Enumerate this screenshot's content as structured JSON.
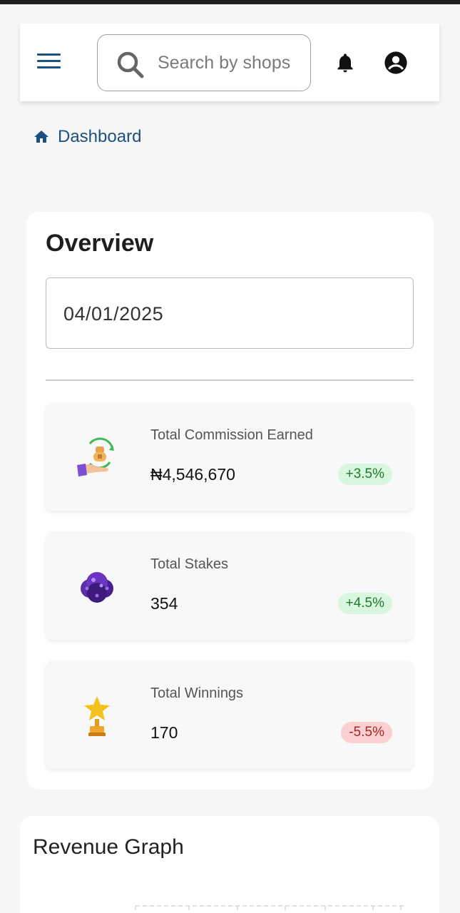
{
  "header": {
    "search_placeholder": "Search by shops",
    "icons": {
      "menu": "menu-icon",
      "search": "search-icon",
      "bell": "bell-icon",
      "account": "account-circle-icon"
    }
  },
  "breadcrumb": {
    "label": "Dashboard",
    "icon": "home-icon"
  },
  "overview": {
    "title": "Overview",
    "date_value": "04/01/2025",
    "stats": [
      {
        "label": "Total Commission Earned",
        "value": "₦4,546,670",
        "change": "+3.5%",
        "trend": "up",
        "icon": "hand-coin-icon"
      },
      {
        "label": "Total Stakes",
        "value": "354",
        "change": "+4.5%",
        "trend": "up",
        "icon": "dice-icon"
      },
      {
        "label": "Total Winnings",
        "value": "170",
        "change": "-5.5%",
        "trend": "down",
        "icon": "trophy-star-icon"
      }
    ]
  },
  "revenue": {
    "title": "Revenue Graph"
  },
  "colors": {
    "primary": "#1d4f80",
    "badge_up_bg": "#d9f7de",
    "badge_up_text": "#1f7a2e",
    "badge_down_bg": "#fad0d0",
    "badge_down_text": "#a92525"
  }
}
